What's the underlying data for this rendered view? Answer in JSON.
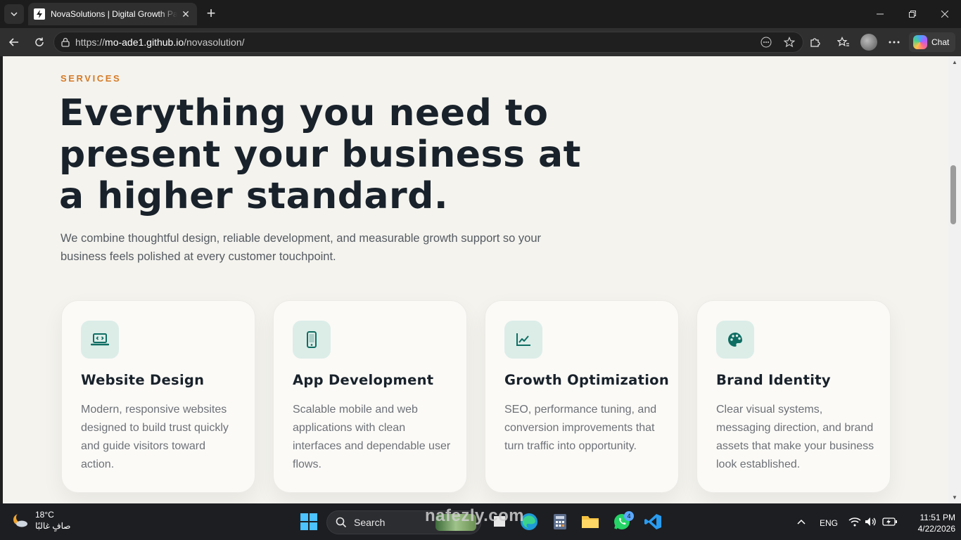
{
  "browser": {
    "tab_title": "NovaSolutions | Digital Growth Partner",
    "url_prefix": "https://",
    "url_host": "mo-ade1.github.io",
    "url_path": "/novasolution/",
    "chat_label": "Chat"
  },
  "page": {
    "eyebrow": "SERVICES",
    "headline": "Everything you need to present your business at a higher standard.",
    "lede": "We combine thoughtful design, reliable development, and measurable growth support so your business feels polished at every customer touchpoint.",
    "accent_color": "#d57a25",
    "icon_tint": "#0f6e63",
    "cards": [
      {
        "icon": "laptop-code-icon",
        "title": "Website Design",
        "desc": "Modern, responsive websites designed to build trust quickly and guide visitors toward action."
      },
      {
        "icon": "mobile-icon",
        "title": "App Development",
        "desc": "Scalable mobile and web applications with clean interfaces and dependable user flows."
      },
      {
        "icon": "chart-line-icon",
        "title": "Growth Optimization",
        "desc": "SEO, performance tuning, and conversion improvements that turn traffic into opportunity."
      },
      {
        "icon": "palette-icon",
        "title": "Brand Identity",
        "desc": "Clear visual systems, messaging direction, and brand assets that make your business look established."
      }
    ]
  },
  "taskbar": {
    "temperature": "18°C",
    "weather_text": "صافٍ غالبًا",
    "search_label": "Search",
    "whatsapp_badge": "4",
    "language": "ENG",
    "time": "11:51 PM",
    "date": "4/22/2026",
    "watermark": "nafezly.com"
  }
}
